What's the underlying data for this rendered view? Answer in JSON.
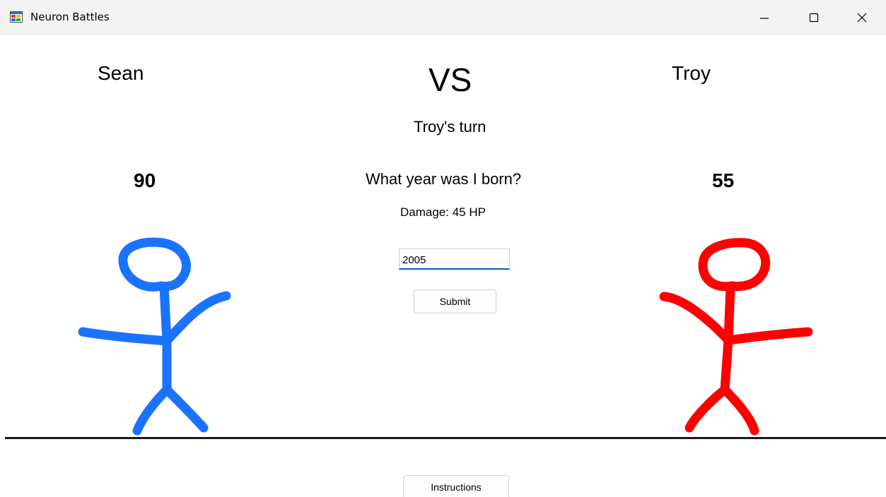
{
  "window": {
    "title": "Neuron Battles",
    "icon": "app-window-icon",
    "controls": [
      "minimize-icon",
      "maximize-icon",
      "close-icon"
    ]
  },
  "players": {
    "left": {
      "name": "Sean",
      "hp": "90",
      "color": "#1a73ff"
    },
    "right": {
      "name": "Troy",
      "hp": "55",
      "color": "#ff0000"
    }
  },
  "battle": {
    "vs_label": "VS",
    "turn_text": "Troy's turn",
    "question": "What year was I born?",
    "damage_text": "Damage: 45 HP"
  },
  "answer": {
    "value": "2005"
  },
  "buttons": {
    "submit_label": "Submit",
    "instructions_label": "Instructions"
  }
}
